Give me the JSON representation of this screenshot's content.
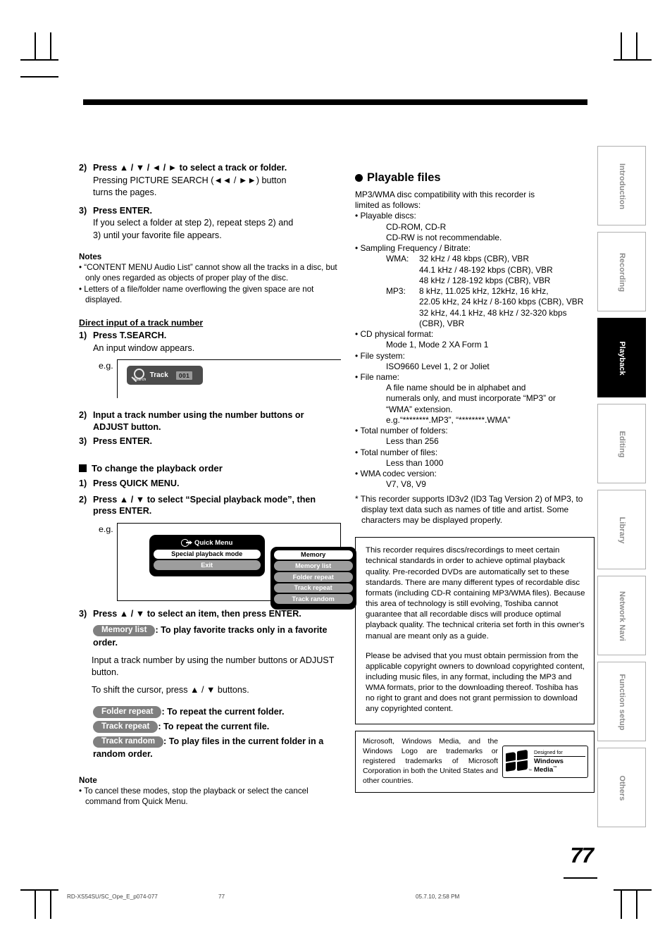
{
  "page": {
    "number": "77",
    "footer": {
      "file": "RD-XS54SU/SC_Ope_E_p074-077",
      "page": "77",
      "date": "05.7.10, 2:58 PM"
    }
  },
  "side_tabs": [
    {
      "label": "Introduction",
      "active": false
    },
    {
      "label": "Recording",
      "active": false
    },
    {
      "label": "Playback",
      "active": true
    },
    {
      "label": "Editing",
      "active": false
    },
    {
      "label": "Library",
      "active": false
    },
    {
      "label": "Network Navi",
      "active": false
    },
    {
      "label": "Function setup",
      "active": false
    },
    {
      "label": "Others",
      "active": false
    }
  ],
  "left": {
    "steps_top": [
      {
        "num": "2)",
        "title": "Press ▲ / ▼ / ◄ / ► to select a track or folder.",
        "body": [
          "Pressing PICTURE SEARCH (◄◄ / ►►) button",
          "turns the pages."
        ]
      },
      {
        "num": "3)",
        "title": "Press ENTER.",
        "body": [
          "If you select a folder at step 2), repeat steps 2) and",
          "3) until your favorite file appears."
        ]
      }
    ],
    "notes_heading": "Notes",
    "notes": [
      "“CONTENT MENU Audio List” cannot show all the tracks in a disc, but only ones regarded as objects of proper play of the disc.",
      "Letters of a file/folder name overflowing the given space are not displayed."
    ],
    "direct_input": {
      "heading": "Direct input of a track number",
      "step1_num": "1)",
      "step1_title": "Press T.SEARCH.",
      "step1_body": "An input window appears.",
      "eg_label": "e.g.",
      "widget": {
        "search_label": "Search",
        "track_label": "Track",
        "number_value": "001"
      },
      "step2_num": "2)",
      "step2_title": "Input a track number using the number buttons or ADJUST button.",
      "step3_num": "3)",
      "step3_title": "Press ENTER."
    },
    "playback_order": {
      "heading": "To change the playback order",
      "step1_num": "1)",
      "step1_title": "Press QUICK MENU.",
      "step2_num": "2)",
      "step2_title": "Press ▲ / ▼ to select “Special playback mode”, then press ENTER.",
      "eg_label": "e.g.",
      "quick_menu": {
        "title": "Quick Menu",
        "items": [
          {
            "label": "Special playback mode",
            "selected": true
          },
          {
            "label": "Exit",
            "selected": false
          }
        ],
        "submenu": [
          {
            "label": "Memory",
            "selected": true
          },
          {
            "label": "Memory list",
            "selected": false
          },
          {
            "label": "Folder repeat",
            "selected": false
          },
          {
            "label": "Track repeat",
            "selected": false
          },
          {
            "label": "Track random",
            "selected": false
          }
        ]
      },
      "step3_num": "3)",
      "step3_title": "Press ▲ / ▼ to select an item, then press ENTER.",
      "modes": [
        {
          "pill": "Memory list",
          "desc": ": To play favorite tracks only in a favorite order.",
          "extra": [
            "Input a track number by using the number buttons or ADJUST button.",
            "To shift the cursor, press ▲ / ▼ buttons."
          ]
        },
        {
          "pill": "Folder repeat",
          "desc": ": To repeat the current folder.",
          "extra": []
        },
        {
          "pill": "Track repeat",
          "desc": ": To repeat the current file.",
          "extra": []
        },
        {
          "pill": "Track random",
          "desc": ": To play files in the current folder in a random order.",
          "extra": []
        }
      ],
      "note_heading": "Note",
      "note": "To cancel these modes, stop the playback or select the cancel command from Quick Menu."
    }
  },
  "right": {
    "heading": "Playable files",
    "intro": [
      "MP3/WMA disc compatibility with this recorder is",
      "limited as follows:"
    ],
    "specs": [
      {
        "bullet": "Playable discs:",
        "lines": [
          "CD-ROM, CD-R",
          "CD-RW is not recommendable."
        ]
      },
      {
        "bullet": "Sampling Frequency / Bitrate:",
        "pairs": [
          {
            "key": "WMA:",
            "values": [
              "32 kHz / 48 kbps (CBR), VBR",
              "44.1 kHz / 48-192 kbps (CBR), VBR",
              "48 kHz / 128-192 kbps (CBR), VBR"
            ]
          },
          {
            "key": "MP3:",
            "values": [
              "8 kHz, 11.025 kHz, 12kHz, 16 kHz,",
              "22.05 kHz, 24 kHz / 8-160 kbps (CBR), VBR",
              "32 kHz, 44.1 kHz, 48 kHz / 32-320 kbps",
              "(CBR), VBR"
            ]
          }
        ]
      },
      {
        "bullet": "CD physical format:",
        "lines": [
          "Mode 1, Mode 2 XA Form 1"
        ]
      },
      {
        "bullet": "File system:",
        "lines": [
          "ISO9660 Level 1, 2 or Joliet"
        ]
      },
      {
        "bullet": "File name:",
        "lines": [
          "A file name should be in alphabet and",
          "numerals only, and must incorporate “MP3” or",
          "“WMA” extension.",
          "e.g.“********.MP3”, “********.WMA”"
        ]
      },
      {
        "bullet": "Total number of folders:",
        "lines": [
          "Less than 256"
        ]
      },
      {
        "bullet": "Total number of files:",
        "lines": [
          "Less than 1000"
        ]
      },
      {
        "bullet": "WMA codec version:",
        "lines": [
          "V7, V8, V9"
        ]
      }
    ],
    "footnote": "* This recorder supports ID3v2 (ID3 Tag Version 2) of MP3, to display text data such as names of title and artist. Some characters may be displayed properly.",
    "disclaimer": [
      "This recorder requires discs/recordings to meet certain technical standards in order to achieve optimal playback quality.  Pre-recorded DVDs are automatically set to these standards. There are many different types of recordable disc formats (including CD-R containing MP3/WMA files).  Because this area of technology is still evolving, Toshiba cannot guarantee that all recordable discs will produce optimal playback quality. The technical criteria set forth in this owner's manual are meant only as a guide.",
      "Please be advised that you must obtain permission from the applicable copyright owners to download copyrighted content, including music files, in any format, including the MP3 and WMA formats, prior to the downloading thereof. Toshiba has no right to grant and does not grant permission to download any copyrighted content."
    ],
    "trademark": {
      "text": "Microsoft, Windows Media, and the Windows Logo are trademarks or registered trademarks of Microsoft Corporation in both the United States and other countries.",
      "logo_designed": "Designed for",
      "logo_name": "Windows",
      "logo_name2": "Media",
      "logo_tm": "™"
    }
  }
}
